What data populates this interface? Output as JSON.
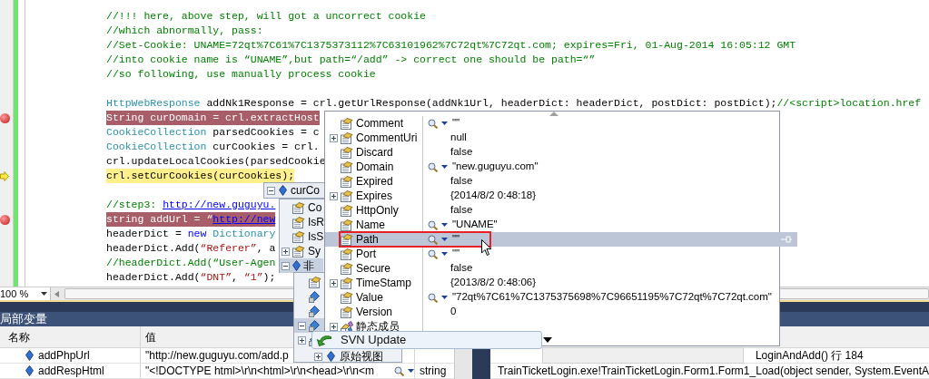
{
  "editor": {
    "lines": [
      {
        "kind": "code",
        "breakpoint": false,
        "current": false,
        "segments": [
          {
            "kind": "comment",
            "text": "//!!! here, above step, will got a uncorrect cookie"
          }
        ]
      },
      {
        "kind": "code",
        "breakpoint": false,
        "current": false,
        "segments": [
          {
            "kind": "comment",
            "text": "//which abnormally, pass:"
          }
        ]
      },
      {
        "kind": "code",
        "breakpoint": false,
        "current": false,
        "segments": [
          {
            "kind": "comment",
            "text": "//Set-Cookie: UNAME=72qt%7C61%7C1375373112%7C63101962%7C72qt%7C72qt.com; expires=Fri, 01-Aug-2014 16:05:12 GMT"
          }
        ]
      },
      {
        "kind": "code",
        "breakpoint": false,
        "current": false,
        "segments": [
          {
            "kind": "comment",
            "text": "//into cookie name is “UNAME”,but path=“/add” -> correct one should be path=“”"
          }
        ]
      },
      {
        "kind": "code",
        "breakpoint": false,
        "current": false,
        "segments": [
          {
            "kind": "comment",
            "text": "//so following, use manually process cookie"
          }
        ]
      },
      {
        "kind": "blank",
        "breakpoint": false,
        "current": false
      },
      {
        "kind": "code",
        "breakpoint": false,
        "current": false,
        "segments": [
          {
            "kind": "type",
            "text": "HttpWebResponse"
          },
          {
            "kind": "plain",
            "text": " addNk1Response = crl.getUrlResponse(addNk1Url, headerDict: headerDict, postDict: postDict);"
          },
          {
            "kind": "comment",
            "text": "//<script>location.href"
          }
        ]
      },
      {
        "kind": "code",
        "breakpoint": true,
        "current": false,
        "segments": [
          {
            "kind": "plain",
            "text": "String curDomain = crl.extractHost"
          }
        ]
      },
      {
        "kind": "code",
        "breakpoint": false,
        "current": false,
        "segments": [
          {
            "kind": "type",
            "text": "CookieCollection"
          },
          {
            "kind": "plain",
            "text": " parsedCookies = c"
          }
        ]
      },
      {
        "kind": "code",
        "breakpoint": false,
        "current": false,
        "segments": [
          {
            "kind": "type",
            "text": "CookieCollection"
          },
          {
            "kind": "plain",
            "text": " curCookies = crl."
          }
        ]
      },
      {
        "kind": "code",
        "breakpoint": false,
        "current": false,
        "segments": [
          {
            "kind": "plain",
            "text": "crl.updateLocalCookies(parsedCookie"
          }
        ]
      },
      {
        "kind": "code",
        "breakpoint": false,
        "current": true,
        "segments": [
          {
            "kind": "plain",
            "text": "crl.setCurCookies(curCookies);"
          }
        ]
      },
      {
        "kind": "blank",
        "breakpoint": false,
        "current": false
      },
      {
        "kind": "code",
        "breakpoint": false,
        "current": false,
        "segments": [
          {
            "kind": "comment",
            "text": "//step3: "
          },
          {
            "kind": "link",
            "text": "http://new.guguyu."
          }
        ]
      },
      {
        "kind": "code",
        "breakpoint": true,
        "current": false,
        "segments": [
          {
            "kind": "plain",
            "text": "string addUrl = “"
          },
          {
            "kind": "link",
            "text": "http://new"
          }
        ]
      },
      {
        "kind": "code",
        "breakpoint": false,
        "current": false,
        "segments": [
          {
            "kind": "plain",
            "text": "headerDict = "
          },
          {
            "kind": "keyword",
            "text": "new"
          },
          {
            "kind": "type",
            "text": " Dictionary"
          }
        ]
      },
      {
        "kind": "code",
        "breakpoint": false,
        "current": false,
        "segments": [
          {
            "kind": "plain",
            "text": "headerDict.Add("
          },
          {
            "kind": "string",
            "text": "“Referer”"
          },
          {
            "kind": "plain",
            "text": ", a"
          }
        ]
      },
      {
        "kind": "code",
        "breakpoint": false,
        "current": false,
        "segments": [
          {
            "kind": "comment",
            "text": "//headerDict.Add(“User-Agen"
          }
        ]
      },
      {
        "kind": "code",
        "breakpoint": false,
        "current": false,
        "segments": [
          {
            "kind": "plain",
            "text": "headerDict.Add("
          },
          {
            "kind": "string",
            "text": "“DNT”"
          },
          {
            "kind": "plain",
            "text": ", "
          },
          {
            "kind": "string",
            "text": "“1”"
          },
          {
            "kind": "plain",
            "text": ");"
          }
        ]
      }
    ]
  },
  "zoom": {
    "value": "100 %"
  },
  "locals": {
    "title": "局部变量",
    "columns": [
      "名称",
      "值"
    ],
    "rows": [
      {
        "name": "addPhpUrl",
        "value": "\"http://new.guguyu.com/add.p",
        "inspectable": false
      },
      {
        "name": "addRespHtml",
        "value": "\"<!DOCTYPE html>\\r\\n<html>\\r\\n<head>\\r\\n<m",
        "inspectable": true,
        "type": "string"
      }
    ]
  },
  "call_stack": {
    "rows": [
      "LoginAndAdd() 行 184",
      "TrainTicketLogin.exe!TrainTicketLogin.Form1.Form1_Load(object sender, System.EventA"
    ]
  },
  "datatip": {
    "header": "curCo",
    "expanded": true,
    "rows": [
      {
        "name": "Co",
        "expandable": false,
        "selected": false
      },
      {
        "name": "IsR",
        "expandable": false,
        "selected": false
      },
      {
        "name": "IsS",
        "expandable": false,
        "selected": false
      },
      {
        "name": "Sy",
        "expandable": true,
        "expanded": false,
        "selected": false
      },
      {
        "name": "非",
        "expandable": true,
        "expanded": true,
        "selected": true,
        "kind": "group"
      }
    ],
    "nested": [
      {
        "kind": "property",
        "expandable": false,
        "selected": false
      },
      {
        "kind": "field",
        "expandable": false,
        "selected": false
      },
      {
        "kind": "field",
        "expandable": false,
        "selected": false
      },
      {
        "kind": "field",
        "expandable": true,
        "expanded": true,
        "selected": true
      },
      {
        "kind": "field",
        "expandable": true,
        "expanded": false,
        "selected": false
      }
    ],
    "raw_view": {
      "label": "原始视图",
      "expandable": true,
      "expanded": false
    }
  },
  "member_tip": {
    "rows": [
      {
        "kind": "property",
        "name": "Comment",
        "value": "\"\"",
        "inspectable": true,
        "expandable": false,
        "selected": false
      },
      {
        "kind": "property",
        "name": "CommentUri",
        "value": "null",
        "inspectable": false,
        "expandable": true,
        "expanded": false,
        "selected": false
      },
      {
        "kind": "property",
        "name": "Discard",
        "value": "false",
        "inspectable": false,
        "expandable": false,
        "selected": false
      },
      {
        "kind": "property",
        "name": "Domain",
        "value": "\"new.guguyu.com\"",
        "inspectable": true,
        "expandable": false,
        "selected": false
      },
      {
        "kind": "property",
        "name": "Expired",
        "value": "false",
        "inspectable": false,
        "expandable": false,
        "selected": false
      },
      {
        "kind": "property",
        "name": "Expires",
        "value": "{2014/8/2 0:48:18}",
        "inspectable": false,
        "expandable": true,
        "expanded": false,
        "selected": false
      },
      {
        "kind": "property",
        "name": "HttpOnly",
        "value": "false",
        "inspectable": false,
        "expandable": false,
        "selected": false
      },
      {
        "kind": "property",
        "name": "Name",
        "value": "\"UNAME\"",
        "inspectable": true,
        "expandable": false,
        "selected": false
      },
      {
        "kind": "property",
        "name": "Path",
        "value": "\"\"",
        "inspectable": true,
        "expandable": false,
        "selected": true
      },
      {
        "kind": "property",
        "name": "Port",
        "value": "\"\"",
        "inspectable": true,
        "expandable": false,
        "selected": false
      },
      {
        "kind": "property",
        "name": "Secure",
        "value": "false",
        "inspectable": false,
        "expandable": false,
        "selected": false
      },
      {
        "kind": "property",
        "name": "TimeStamp",
        "value": "{2013/8/2 0:48:06}",
        "inspectable": false,
        "expandable": true,
        "expanded": false,
        "selected": false
      },
      {
        "kind": "property",
        "name": "Value",
        "value": "\"72qt%7C61%7C1375375698%7C96651195%7C72qt%7C72qt.com\"",
        "inspectable": true,
        "expandable": false,
        "selected": false
      },
      {
        "kind": "property",
        "name": "Version",
        "value": "0",
        "inspectable": false,
        "expandable": false,
        "selected": false
      },
      {
        "kind": "static",
        "name": "静态成员",
        "expandable": true,
        "expanded": false,
        "selected": false
      }
    ]
  },
  "context_tooltip": {
    "label": "SVN Update"
  }
}
